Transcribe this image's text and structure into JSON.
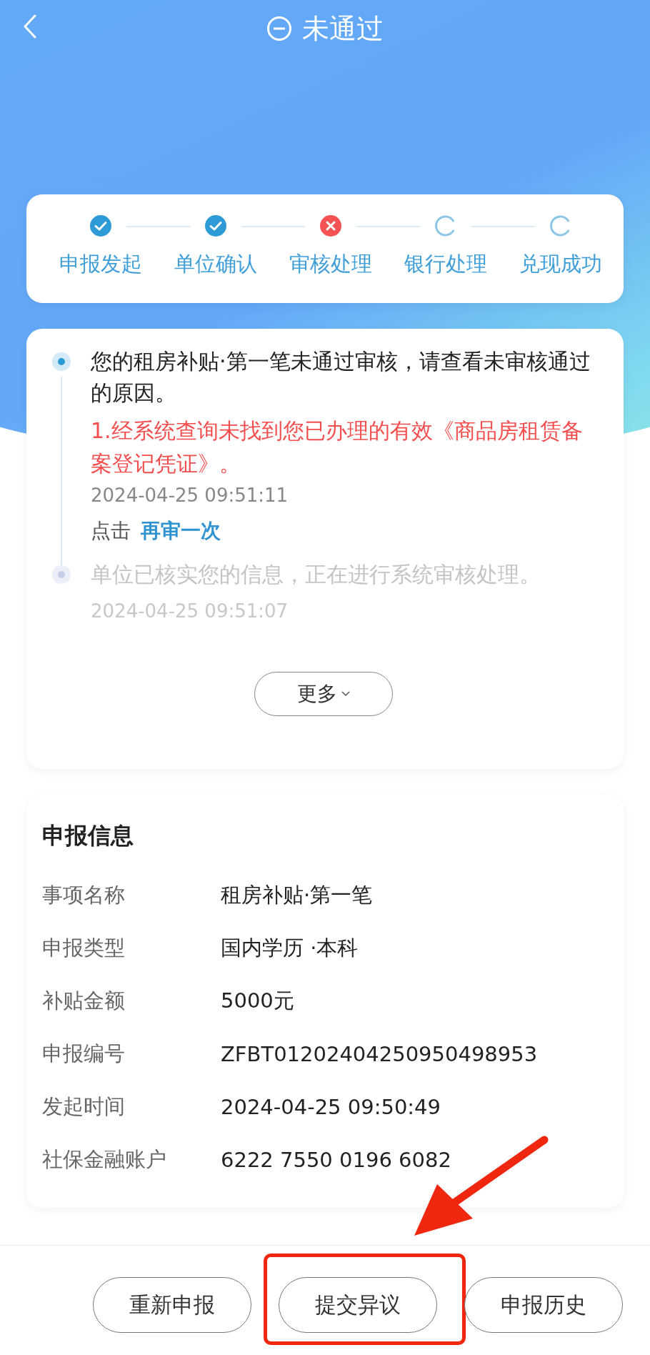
{
  "header": {
    "title": "未通过"
  },
  "steps": [
    {
      "label": "申报发起",
      "kind": "done"
    },
    {
      "label": "单位确认",
      "kind": "done"
    },
    {
      "label": "审核处理",
      "kind": "failed"
    },
    {
      "label": "银行处理",
      "kind": "pending"
    },
    {
      "label": "兑现成功",
      "kind": "pending"
    }
  ],
  "timeline": [
    {
      "active": true,
      "message": "您的租房补贴·第一笔未通过审核，请查看未审核通过的原因。",
      "reason": "1.经系统查询未找到您已办理的有效《商品房租赁备案登记凭证》。",
      "time": "2024-04-25 09:51:11",
      "action_prefix": "点击",
      "action_link": "再审一次"
    },
    {
      "active": false,
      "message": "单位已核实您的信息，正在进行系统审核处理。",
      "time": "2024-04-25 09:51:07"
    }
  ],
  "more_button": "更多",
  "info": {
    "title": "申报信息",
    "rows": [
      {
        "label": "事项名称",
        "value": "租房补贴·第一笔"
      },
      {
        "label": "申报类型",
        "value": "国内学历 ·本科"
      },
      {
        "label": "补贴金额",
        "value": "5000元"
      },
      {
        "label": "申报编号",
        "value": "ZFBT01202404250950498953"
      },
      {
        "label": "发起时间",
        "value": "2024-04-25 09:50:49"
      },
      {
        "label": "社保金融账户",
        "value": "6222 7550 0196 6082"
      }
    ]
  },
  "footer_buttons": [
    {
      "label": "重新申报",
      "highlighted": false
    },
    {
      "label": "提交异议",
      "highlighted": true
    },
    {
      "label": "申报历史",
      "highlighted": false
    }
  ]
}
